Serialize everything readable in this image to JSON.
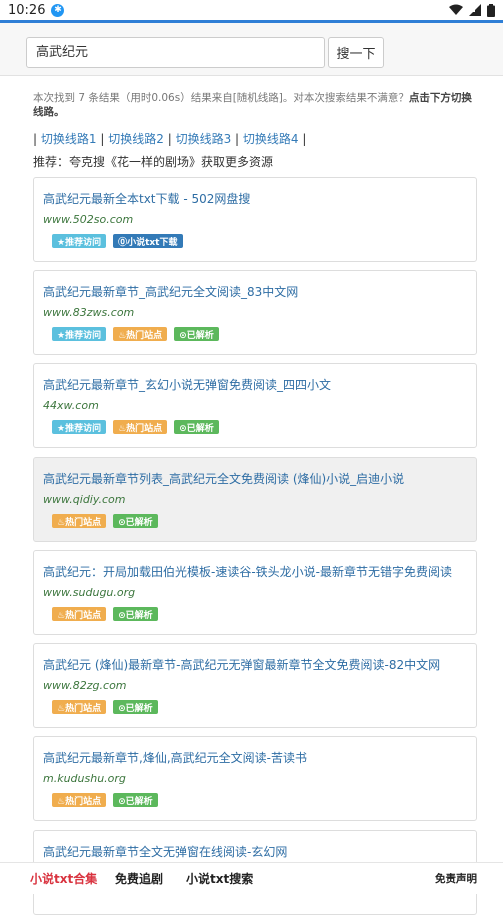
{
  "status": {
    "time": "10:26"
  },
  "progress": {
    "percent": 100
  },
  "search": {
    "value": "高武纪元",
    "button": "搜一下"
  },
  "info": {
    "text": "本次找到 7 条结果（用时0.06s）结果来自[随机线路]。对本次搜索结果不满意？",
    "strong": "点击下方切换线路。"
  },
  "lines": {
    "sep": "|",
    "items": [
      "切换线路1",
      "切换线路2",
      "切换线路3",
      "切换线路4"
    ]
  },
  "recommend": "推荐：夸克搜《花一样的剧场》获取更多资源",
  "results": [
    {
      "title": "高武纪元最新全本txt下载 - 502网盘搜",
      "url": "www.502so.com",
      "badges": [
        "★推荐访问",
        "⓪小说txt下载"
      ]
    },
    {
      "title": "高武纪元最新章节_高武纪元全文阅读_83中文网",
      "url": "www.83zws.com",
      "badges": [
        "★推荐访问",
        "♨热门站点",
        "⊙已解析"
      ]
    },
    {
      "title": "高武纪元最新章节_玄幻小说无弹窗免费阅读_四四小文",
      "url": "44xw.com",
      "badges": [
        "★推荐访问",
        "♨热门站点",
        "⊙已解析"
      ]
    },
    {
      "title": "高武纪元最新章节列表_高武纪元全文免费阅读 (烽仙)小说_启迪小说",
      "url": "www.qidiy.com",
      "badges": [
        "♨热门站点",
        "⊙已解析"
      ]
    },
    {
      "title": "高武纪元：开局加载田伯光模板-速读谷-铁头龙小说-最新章节无错字免费阅读",
      "url": "www.sudugu.org",
      "badges": [
        "♨热门站点",
        "⊙已解析"
      ]
    },
    {
      "title": "高武纪元 (烽仙)最新章节-高武纪元无弹窗最新章节全文免费阅读-82中文网",
      "url": "www.82zg.com",
      "badges": [
        "♨热门站点",
        "⊙已解析"
      ]
    },
    {
      "title": "高武纪元最新章节,烽仙,高武纪元全文阅读-苦读书",
      "url": "m.kudushu.org",
      "badges": [
        "♨热门站点",
        "⊙已解析"
      ]
    },
    {
      "title": "高武纪元最新章节全文无弹窗在线阅读-玄幻网",
      "url": "",
      "badges": []
    }
  ],
  "bottom": {
    "nav1": "小说txt合集",
    "nav2": "免费追剧",
    "nav3": "小说txt搜索",
    "disclaimer": "免责声明"
  }
}
